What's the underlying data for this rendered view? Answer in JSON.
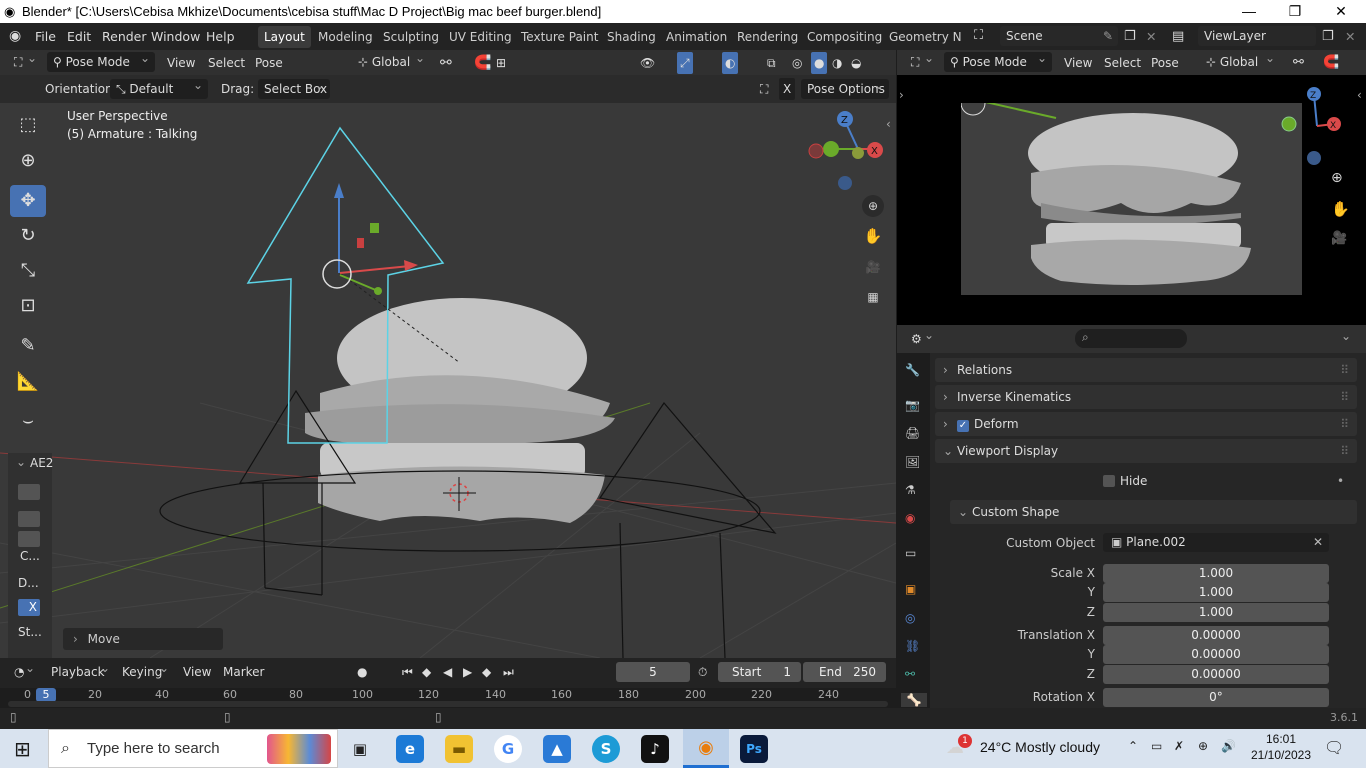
{
  "titlebar": {
    "title": "Blender* [C:\\Users\\Cebisa Mkhize\\Documents\\cebisa stuff\\Mac D Project\\Big mac beef burger.blend]"
  },
  "menu": [
    "File",
    "Edit",
    "Render",
    "Window",
    "Help"
  ],
  "workspaces": [
    "Layout",
    "Modeling",
    "Sculpting",
    "UV Editing",
    "Texture Paint",
    "Shading",
    "Animation",
    "Rendering",
    "Compositing",
    "Geometry Noc"
  ],
  "scene": {
    "name": "Scene",
    "view_layer": "ViewLayer"
  },
  "viewport_header": {
    "mode": "Pose Mode",
    "view": "View",
    "select": "Select",
    "pose": "Pose",
    "transform": "Global"
  },
  "tool_header": {
    "orientation_label": "Orientation:",
    "orientation_value": "Default",
    "drag_label": "Drag:",
    "drag_value": "Select Box",
    "x_label": "X",
    "pose_options": "Pose Options"
  },
  "viewport": {
    "perspective": "User Perspective",
    "object_info": "(5) Armature : Talking",
    "last_op": "Move"
  },
  "tool_panel": {
    "title": "AE2",
    "c_label": "C...",
    "d_label": "D...",
    "x_label": "X",
    "st_label": "St..."
  },
  "side_viewport": {
    "mode": "Pose Mode",
    "view": "View",
    "select": "Select",
    "pose": "Pose",
    "transform": "Global"
  },
  "properties": {
    "search_placeholder": "",
    "relations": "Relations",
    "ik": "Inverse Kinematics",
    "deform": "Deform",
    "viewport_display": "Viewport Display",
    "hide": "Hide",
    "custom_shape": "Custom Shape",
    "custom_object_label": "Custom Object",
    "custom_object_value": "Plane.002",
    "scale_x_label": "Scale X",
    "scale_x": "1.000",
    "scale_y_label": "Y",
    "scale_y": "1.000",
    "scale_z_label": "Z",
    "scale_z": "1.000",
    "trans_x_label": "Translation X",
    "trans_x": "0.00000",
    "trans_y_label": "Y",
    "trans_y": "0.00000",
    "trans_z_label": "Z",
    "trans_z": "0.00000",
    "rot_x_label": "Rotation X",
    "rot_x": "0°"
  },
  "timeline": {
    "playback": "Playback",
    "keying": "Keying",
    "view": "View",
    "marker": "Marker",
    "current_frame": "5",
    "start_label": "Start",
    "start": "1",
    "end_label": "End",
    "end": "250",
    "ruler": [
      "0",
      "20",
      "40",
      "60",
      "80",
      "100",
      "120",
      "140",
      "160",
      "180",
      "200",
      "220",
      "240"
    ],
    "playhead": "5"
  },
  "status": {
    "version": "3.6.1"
  },
  "taskbar": {
    "search_placeholder": "Type here to search",
    "weather": "24°C  Mostly cloudy",
    "time": "16:01",
    "date": "21/10/2023",
    "notification_badge": "1"
  }
}
